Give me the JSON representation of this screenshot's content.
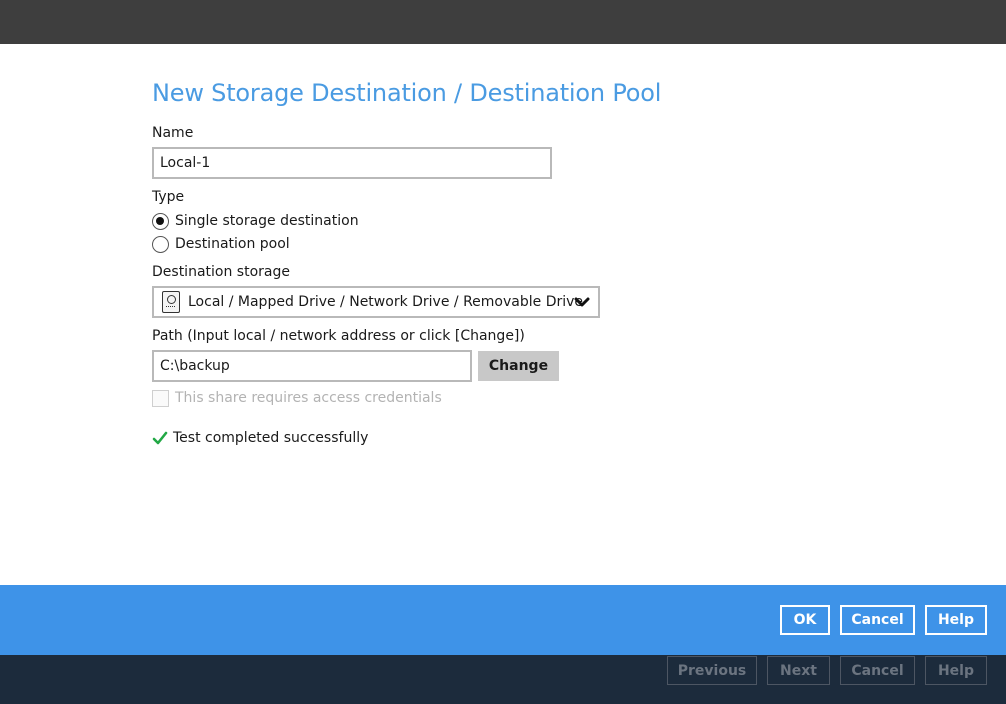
{
  "dialog": {
    "title": "New Storage Destination / Destination Pool"
  },
  "form": {
    "name_label": "Name",
    "name_value": "Local-1",
    "type_label": "Type",
    "type_options": [
      {
        "label": "Single storage destination",
        "checked": true
      },
      {
        "label": "Destination pool",
        "checked": false
      }
    ],
    "destination_label": "Destination storage",
    "destination_value": "Local / Mapped Drive / Network Drive / Removable Drive",
    "path_label": "Path (Input local / network address or click [Change])",
    "path_value": "C:\\backup",
    "change_label": "Change",
    "credentials_label": "This share requires access credentials",
    "credentials_checked": false,
    "status_text": "Test completed successfully"
  },
  "dialog_buttons": {
    "ok": "OK",
    "cancel": "Cancel",
    "help": "Help"
  },
  "wizard_buttons": {
    "previous": "Previous",
    "next": "Next",
    "cancel": "Cancel",
    "help": "Help"
  },
  "colors": {
    "accent": "#4a9be2",
    "blue_bar": "#3e93e8",
    "top_bar": "#3e3e3e",
    "bottom_bar": "#1c2b3c",
    "success": "#22a845"
  },
  "icons": {
    "drive": "hard-drive-icon",
    "dropdown": "chevron-down-icon",
    "status": "checkmark-icon"
  }
}
